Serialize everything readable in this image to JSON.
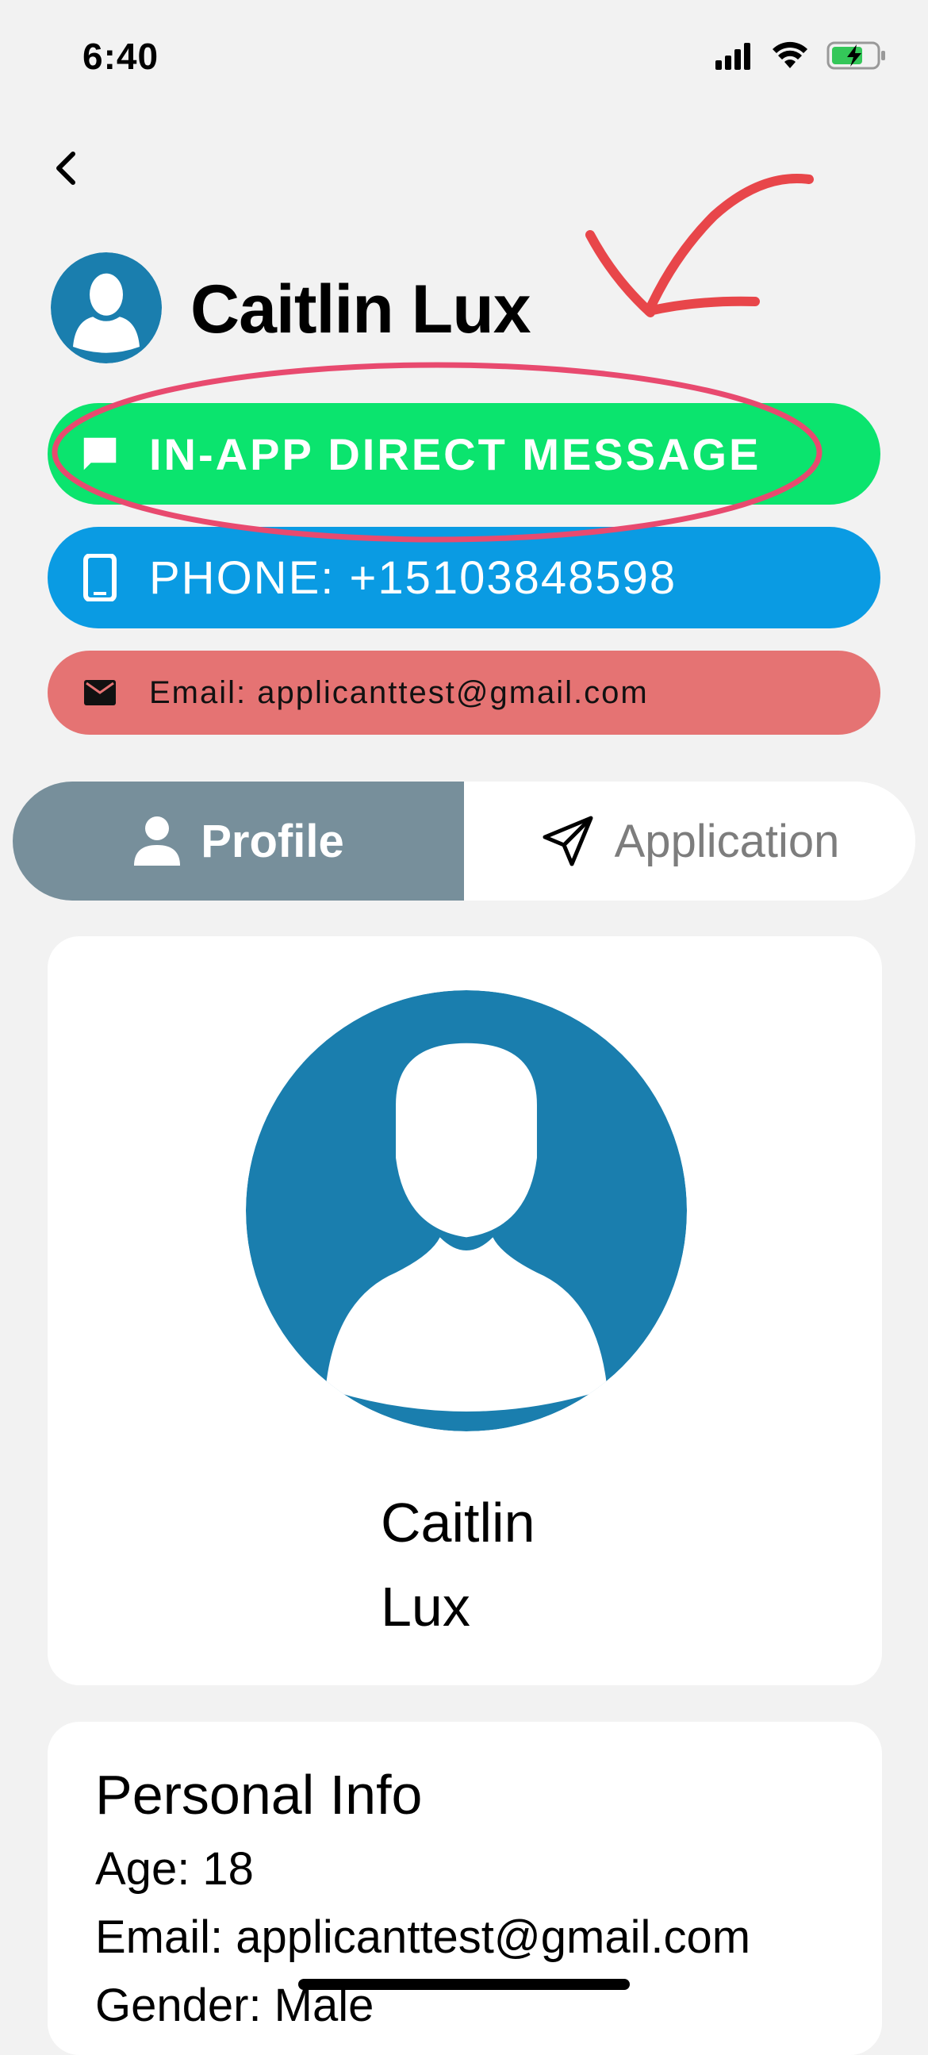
{
  "status_bar": {
    "time": "6:40"
  },
  "header": {
    "name": "Caitlin Lux"
  },
  "actions": {
    "direct_message": "IN-APP DIRECT MESSAGE",
    "phone": "PHONE: +15103848598",
    "email": "Email: applicanttest@gmail.com"
  },
  "tabs": [
    {
      "label": "Profile",
      "icon": "person-icon",
      "active": true
    },
    {
      "label": "Application",
      "icon": "send-icon",
      "active": false
    }
  ],
  "profile_card": {
    "first_name": "Caitlin",
    "last_name": "Lux"
  },
  "personal_info": {
    "title": "Personal Info",
    "age": "Age: 18",
    "email": "Email: applicanttest@gmail.com",
    "gender": "Gender: Male"
  },
  "colors": {
    "dm_green": "#0be46e",
    "phone_blue": "#0a9be3",
    "email_red": "#e57373",
    "avatar_blue": "#1a7eae",
    "tab_active": "#778f9b",
    "annotation_red": "#e84a6f"
  }
}
